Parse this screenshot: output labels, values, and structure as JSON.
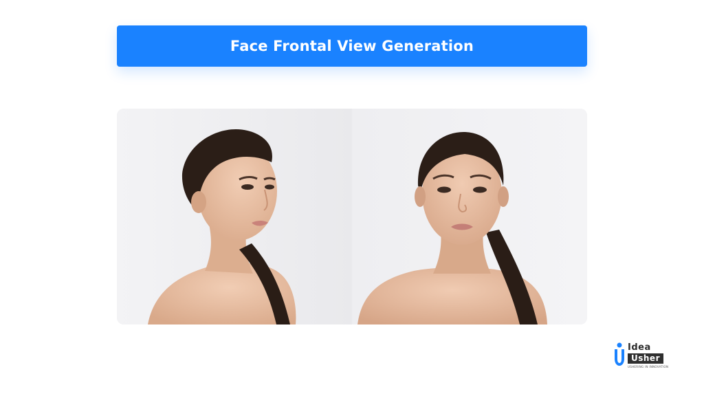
{
  "header": {
    "title": "Face Frontal View Generation"
  },
  "comparison": {
    "left_image": "face-side-view-photo",
    "right_image": "face-frontal-view-photo"
  },
  "brand": {
    "word1": "Idea",
    "word2": "Usher",
    "tagline": "USHERING IN INNOVATION",
    "accent_color": "#1a82ff",
    "dark_color": "#2f2f2f"
  }
}
